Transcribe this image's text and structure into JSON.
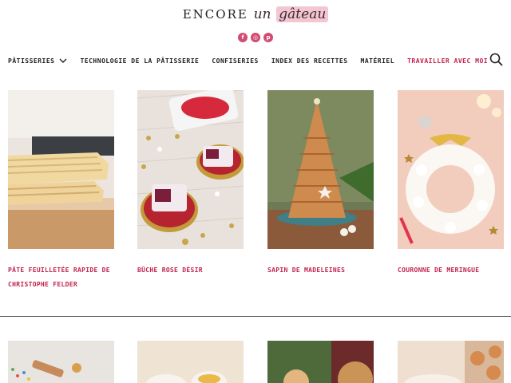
{
  "site": {
    "logo_main": "ENCORE",
    "logo_script_1": "un",
    "logo_script_2": "gâteau"
  },
  "social": [
    {
      "icon": "facebook-icon",
      "glyph": "f"
    },
    {
      "icon": "instagram-icon",
      "glyph": "◎"
    },
    {
      "icon": "pinterest-icon",
      "glyph": "p"
    }
  ],
  "nav": {
    "items": [
      {
        "label": "Pâtisseries"
      },
      {
        "label": "Technologie de la pâtisserie"
      },
      {
        "label": "Confiseries"
      },
      {
        "label": "Index des recettes"
      },
      {
        "label": "Matériel"
      },
      {
        "label": "Travailler avec moi"
      }
    ],
    "accent_color": "#c2224f"
  },
  "recipes": [
    {
      "title": "Pâte feuilletée rapide de Christophe Felder"
    },
    {
      "title": "Bûche rose désir"
    },
    {
      "title": "Sapin de madeleines"
    },
    {
      "title": "Couronne de meringue"
    }
  ]
}
